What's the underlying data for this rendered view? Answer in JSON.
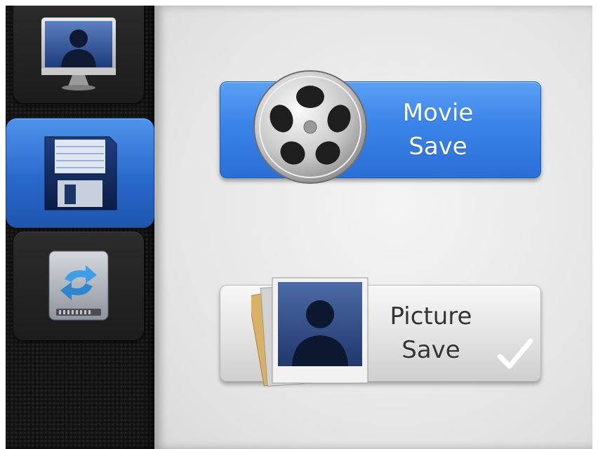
{
  "sidebar": {
    "items": [
      {
        "name": "monitor",
        "icon": "user-monitor-icon",
        "selected": false
      },
      {
        "name": "save",
        "icon": "floppy-disk-icon",
        "selected": true
      },
      {
        "name": "sync",
        "icon": "sync-drive-icon",
        "selected": false
      }
    ]
  },
  "main": {
    "movie_save": {
      "line1": "Movie",
      "line2": "Save",
      "icon": "film-reel-icon",
      "checked": false
    },
    "picture_save": {
      "line1": "Picture",
      "line2": "Save",
      "icon": "photo-stack-icon",
      "checked": true
    }
  },
  "colors": {
    "accent": "#3a84e8",
    "sidebar_bg": "#161616",
    "content_bg": "#e6e6e6"
  }
}
